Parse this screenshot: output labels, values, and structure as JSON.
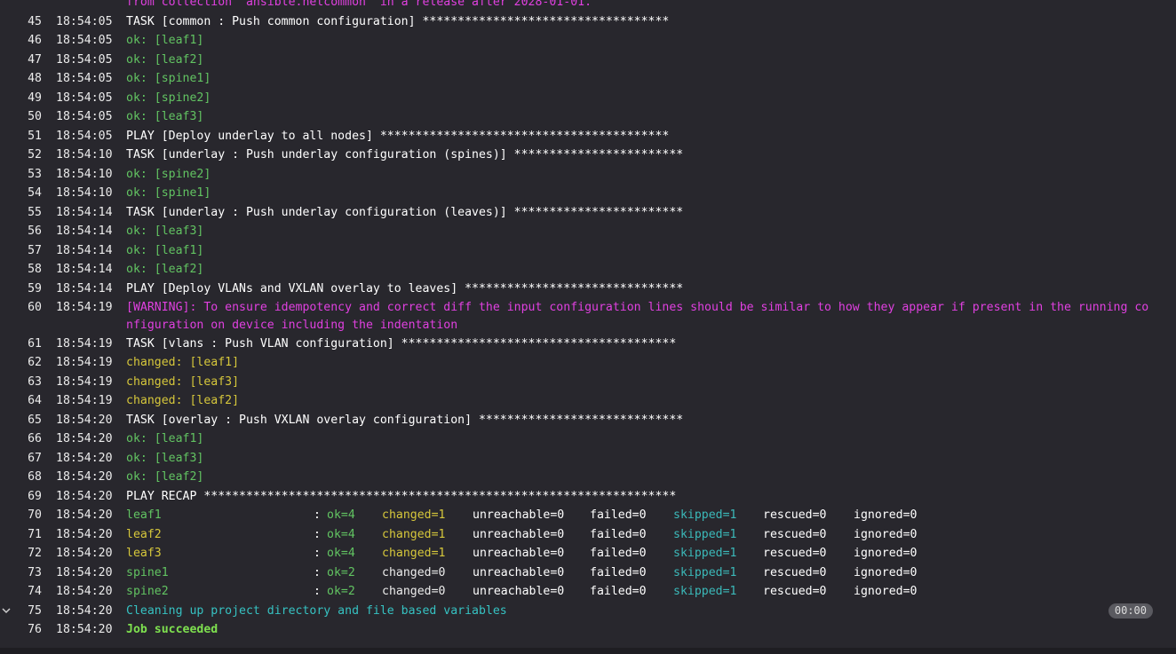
{
  "log": [
    {
      "n": "",
      "t": "",
      "text": "from collection 'ansible.netcommon' in a release after 2028-01-01.",
      "c": "c-magenta"
    },
    {
      "n": "45",
      "t": "18:54:05",
      "text": "TASK [common : Push common configuration] ***********************************",
      "c": "c-white"
    },
    {
      "n": "46",
      "t": "18:54:05",
      "text": "ok: [leaf1]",
      "c": "c-green"
    },
    {
      "n": "47",
      "t": "18:54:05",
      "text": "ok: [leaf2]",
      "c": "c-green"
    },
    {
      "n": "48",
      "t": "18:54:05",
      "text": "ok: [spine1]",
      "c": "c-green"
    },
    {
      "n": "49",
      "t": "18:54:05",
      "text": "ok: [spine2]",
      "c": "c-green"
    },
    {
      "n": "50",
      "t": "18:54:05",
      "text": "ok: [leaf3]",
      "c": "c-green"
    },
    {
      "n": "51",
      "t": "18:54:05",
      "text": "PLAY [Deploy underlay to all nodes] *****************************************",
      "c": "c-white"
    },
    {
      "n": "52",
      "t": "18:54:10",
      "text": "TASK [underlay : Push underlay configuration (spines)] ************************",
      "c": "c-white"
    },
    {
      "n": "53",
      "t": "18:54:10",
      "text": "ok: [spine2]",
      "c": "c-green"
    },
    {
      "n": "54",
      "t": "18:54:10",
      "text": "ok: [spine1]",
      "c": "c-green"
    },
    {
      "n": "55",
      "t": "18:54:14",
      "text": "TASK [underlay : Push underlay configuration (leaves)] ************************",
      "c": "c-white"
    },
    {
      "n": "56",
      "t": "18:54:14",
      "text": "ok: [leaf3]",
      "c": "c-green"
    },
    {
      "n": "57",
      "t": "18:54:14",
      "text": "ok: [leaf1]",
      "c": "c-green"
    },
    {
      "n": "58",
      "t": "18:54:14",
      "text": "ok: [leaf2]",
      "c": "c-green"
    },
    {
      "n": "59",
      "t": "18:54:14",
      "text": "PLAY [Deploy VLANs and VXLAN overlay to leaves] *******************************",
      "c": "c-white"
    },
    {
      "n": "60",
      "t": "18:54:19",
      "text": "[WARNING]: To ensure idempotency and correct diff the input configuration lines should be similar to how they appear if present in the running configuration on device including the indentation",
      "c": "c-magenta",
      "tall": true
    },
    {
      "n": "61",
      "t": "18:54:19",
      "text": "TASK [vlans : Push VLAN configuration] ***************************************",
      "c": "c-white"
    },
    {
      "n": "62",
      "t": "18:54:19",
      "text": "changed: [leaf1]",
      "c": "c-yellow"
    },
    {
      "n": "63",
      "t": "18:54:19",
      "text": "changed: [leaf3]",
      "c": "c-yellow"
    },
    {
      "n": "64",
      "t": "18:54:19",
      "text": "changed: [leaf2]",
      "c": "c-yellow"
    },
    {
      "n": "65",
      "t": "18:54:20",
      "text": "TASK [overlay : Push VXLAN overlay configuration] *****************************",
      "c": "c-white"
    },
    {
      "n": "66",
      "t": "18:54:20",
      "text": "ok: [leaf1]",
      "c": "c-green"
    },
    {
      "n": "67",
      "t": "18:54:20",
      "text": "ok: [leaf3]",
      "c": "c-green"
    },
    {
      "n": "68",
      "t": "18:54:20",
      "text": "ok: [leaf2]",
      "c": "c-green"
    },
    {
      "n": "69",
      "t": "18:54:20",
      "text": "PLAY RECAP *******************************************************************",
      "c": "c-white"
    },
    {
      "n": "70",
      "t": "18:54:20",
      "recap": {
        "host": "leaf1",
        "hc": "c-green",
        "sep": ":",
        "ok": "ok=4",
        "oc": "c-green",
        "changed": "changed=1",
        "cc": "c-yellow",
        "unreach": "unreachable=0",
        "failed": "failed=0",
        "skipped": "skipped=1",
        "rescued": "rescued=0",
        "ignored": "ignored=0"
      }
    },
    {
      "n": "71",
      "t": "18:54:20",
      "recap": {
        "host": "leaf2",
        "hc": "c-yellow",
        "sep": ":",
        "ok": "ok=4",
        "oc": "c-green",
        "changed": "changed=1",
        "cc": "c-yellow",
        "unreach": "unreachable=0",
        "failed": "failed=0",
        "skipped": "skipped=1",
        "rescued": "rescued=0",
        "ignored": "ignored=0"
      }
    },
    {
      "n": "72",
      "t": "18:54:20",
      "recap": {
        "host": "leaf3",
        "hc": "c-yellow",
        "sep": ":",
        "ok": "ok=4",
        "oc": "c-green",
        "changed": "changed=1",
        "cc": "c-yellow",
        "unreach": "unreachable=0",
        "failed": "failed=0",
        "skipped": "skipped=1",
        "rescued": "rescued=0",
        "ignored": "ignored=0"
      }
    },
    {
      "n": "73",
      "t": "18:54:20",
      "recap": {
        "host": "spine1",
        "hc": "c-green",
        "sep": ":",
        "ok": "ok=2",
        "oc": "c-green",
        "changed": "changed=0",
        "cc": "c-plain",
        "unreach": "unreachable=0",
        "failed": "failed=0",
        "skipped": "skipped=1",
        "rescued": "rescued=0",
        "ignored": "ignored=0"
      }
    },
    {
      "n": "74",
      "t": "18:54:20",
      "recap": {
        "host": "spine2",
        "hc": "c-green",
        "sep": ":",
        "ok": "ok=2",
        "oc": "c-green",
        "changed": "changed=0",
        "cc": "c-plain",
        "unreach": "unreachable=0",
        "failed": "failed=0",
        "skipped": "skipped=1",
        "rescued": "rescued=0",
        "ignored": "ignored=0"
      }
    },
    {
      "n": "75",
      "t": "18:54:20",
      "text": "Cleaning up project directory and file based variables",
      "c": "c-cyan",
      "collapsible": true,
      "duration": "00:00"
    },
    {
      "n": "76",
      "t": "18:54:20",
      "text": "Job succeeded",
      "c": "c-lime"
    }
  ],
  "icons": {
    "collapse": "chevron-down-icon"
  }
}
